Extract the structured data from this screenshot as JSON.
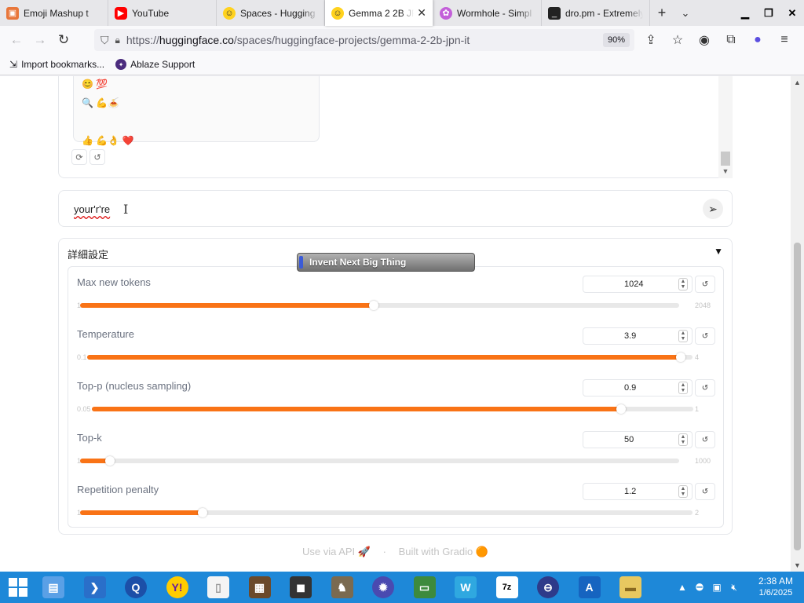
{
  "browser": {
    "tabs": [
      {
        "title": "Emoji Mashup t",
        "favicon": "orange-app-icon",
        "active": false
      },
      {
        "title": "YouTube",
        "favicon": "youtube-icon",
        "active": false
      },
      {
        "title": "Spaces - Hugging",
        "favicon": "huggingface-icon",
        "active": false
      },
      {
        "title": "Gemma 2 2B JP",
        "favicon": "huggingface-icon",
        "active": true
      },
      {
        "title": "Wormhole - Simpl",
        "favicon": "wormhole-icon",
        "active": false
      },
      {
        "title": "dro.pm - Extremely",
        "favicon": "terminal-icon",
        "active": false
      }
    ],
    "url_prefix": "https://",
    "url_host": "huggingface.co",
    "url_path": "/spaces/huggingface-projects/gemma-2-2b-jpn-it",
    "zoom": "90%",
    "bookmarks": [
      {
        "label": "Import bookmarks...",
        "icon": "import-icon"
      },
      {
        "label": "Ablaze Support",
        "icon": "ablaze-icon"
      }
    ]
  },
  "chat": {
    "bubble_lines": [
      "😊 💯",
      "🔍 💪🍝",
      "",
      "👍 💪👌 ❤️"
    ],
    "actions": [
      "retry-icon",
      "undo-icon"
    ]
  },
  "input": {
    "value": "your'r're"
  },
  "settings": {
    "title": "詳細設定",
    "sliders": [
      {
        "label": "Max new tokens",
        "value": "1024",
        "min": "1",
        "max": "2048",
        "fill": 0.49
      },
      {
        "label": "Temperature",
        "value": "3.9",
        "min": "0.1",
        "max": "4",
        "fill": 0.98
      },
      {
        "label": "Top-p (nucleus sampling)",
        "value": "0.9",
        "min": "0.05",
        "max": "1",
        "fill": 0.88
      },
      {
        "label": "Top-k",
        "value": "50",
        "min": "1",
        "max": "1000",
        "fill": 0.05
      },
      {
        "label": "Repetition penalty",
        "value": "1.2",
        "min": "1",
        "max": "2",
        "fill": 0.2
      }
    ]
  },
  "footer": {
    "api": "Use via API 🚀",
    "sep": "·",
    "built": "Built with Gradio 🟠"
  },
  "overlay": {
    "label": "Invent Next Big Thing"
  },
  "taskbar": {
    "clock_time": "2:38 AM",
    "clock_date": "1/6/2025",
    "icons": [
      "file-explorer-icon",
      "powershell-icon",
      "quicktime-icon",
      "yahoo-messenger-icon",
      "blank-file-icon",
      "minecraft-icon",
      "media-icon",
      "gimp-icon",
      "virus-icon",
      "computer-icon",
      "wix-icon",
      "7zip-icon",
      "ablaze-icon",
      "arc-icon",
      "folder-icon"
    ]
  },
  "colors": {
    "accent": "#f97316",
    "taskbar": "#1e88d8"
  }
}
